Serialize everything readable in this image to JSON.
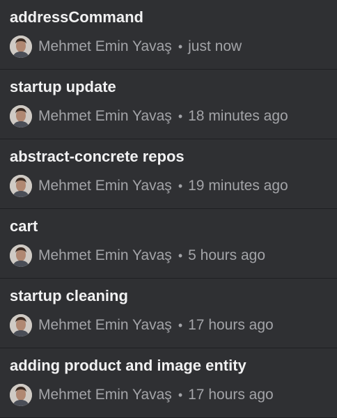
{
  "commits": [
    {
      "title": "addressCommand",
      "author": "Mehmet Emin Yavaş",
      "separator": "•",
      "time": "just now"
    },
    {
      "title": "startup update",
      "author": "Mehmet Emin Yavaş",
      "separator": "•",
      "time": "18 minutes ago"
    },
    {
      "title": "abstract-concrete repos",
      "author": "Mehmet Emin Yavaş",
      "separator": "•",
      "time": "19 minutes ago"
    },
    {
      "title": "cart",
      "author": "Mehmet Emin Yavaş",
      "separator": "•",
      "time": "5 hours ago"
    },
    {
      "title": "startup cleaning",
      "author": "Mehmet Emin Yavaş",
      "separator": "•",
      "time": "17 hours ago"
    },
    {
      "title": "adding product and image entity",
      "author": "Mehmet Emin Yavaş",
      "separator": "•",
      "time": "17 hours ago"
    }
  ],
  "colors": {
    "background": "#2f3033",
    "divider": "#1f2023",
    "title": "#f1f1f2",
    "meta": "#a3a4a8"
  },
  "icons": {
    "avatar": "user-photo-avatar-icon"
  }
}
